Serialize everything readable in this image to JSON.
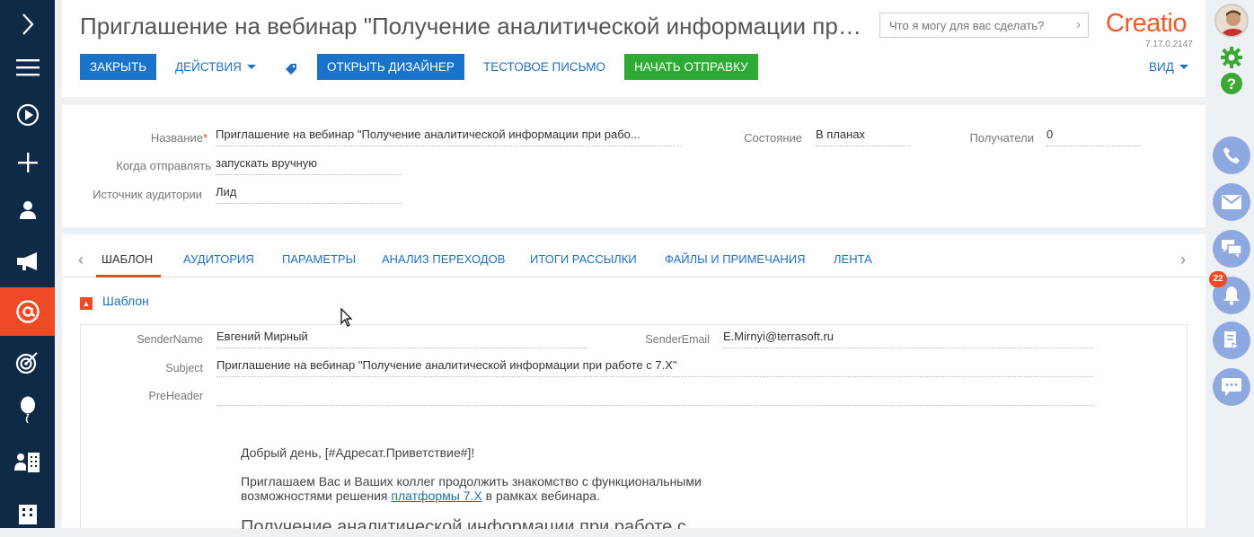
{
  "header": {
    "title": "Приглашение на вебинар \"Получение аналитической информации при ра...",
    "search_placeholder": "Что я могу для вас сделать?",
    "logo": "Creatio",
    "version": "7.17.0.2147",
    "buttons": {
      "close": "ЗАКРЫТЬ",
      "actions": "ДЕЙСТВИЯ",
      "open_designer": "ОТКРЫТЬ ДИЗАЙНЕР",
      "test_email": "ТЕСТОВОЕ ПИСЬМО",
      "start_sending": "НАЧАТЬ ОТПРАВКУ",
      "view": "ВИД"
    }
  },
  "fields": {
    "name_label": "Название",
    "name_value": "Приглашение на вебинар \"Получение аналитической информации при рабо...",
    "send_when_label": "Когда отправлять",
    "send_when_value": "запускать вручную",
    "audience_source_label": "Источник аудитории",
    "audience_source_value": "Лид",
    "state_label": "Состояние",
    "state_value": "В планах",
    "recipients_label": "Получатели",
    "recipients_value": "0"
  },
  "tabs": [
    {
      "label": "ШАБЛОН"
    },
    {
      "label": "АУДИТОРИЯ"
    },
    {
      "label": "ПАРАМЕТРЫ"
    },
    {
      "label": "АНАЛИЗ ПЕРЕХОДОВ"
    },
    {
      "label": "ИТОГИ РАССЫЛКИ"
    },
    {
      "label": "ФАЙЛЫ И ПРИМЕЧАНИЯ"
    },
    {
      "label": "ЛЕНТА"
    }
  ],
  "template": {
    "group_title": "Шаблон",
    "sender_name_label": "SenderName",
    "sender_name_value": "Евгений Мирный",
    "sender_email_label": "SenderEmail",
    "sender_email_value": "E.Mirnyi@terrasoft.ru",
    "subject_label": "Subject",
    "subject_value": "Приглашение на вебинар \"Получение аналитической информации при работе с 7.X\"",
    "preheader_label": "PreHeader",
    "preheader_value": "",
    "body_greeting": "Добрый день, [#Адресат.Приветствие#]!",
    "body_line1": "Приглашаем Вас и Ваших коллег продолжить знакомство с функциональными",
    "body_line2_prefix": "возможностями решения ",
    "body_link": "платформы 7.X",
    "body_line2_suffix": " в рамках вебинара.",
    "body_heading": "Получение аналитической информации при работе с"
  },
  "notifications": {
    "count": "22"
  },
  "colors": {
    "nav_bg": "#0e2a47",
    "accent": "#ee4a25",
    "primary": "#1a73c8",
    "success": "#2eab35",
    "side_circle": "#8ea9e0"
  }
}
